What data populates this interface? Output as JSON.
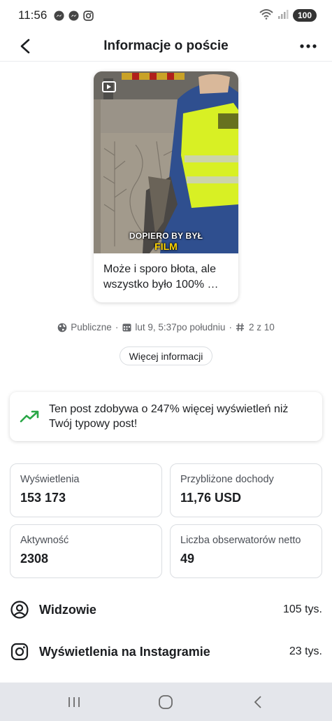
{
  "status_bar": {
    "time": "11:56",
    "battery": "100",
    "icons": [
      "messenger-icon",
      "messenger-icon",
      "instagram-icon",
      "wifi-icon",
      "signal-icon"
    ]
  },
  "header": {
    "title": "Informacje o poście",
    "back_icon": "back-arrow-icon",
    "more_icon": "more-dots-icon"
  },
  "post": {
    "overlay_line1": "DOPIERO BY BYŁ",
    "overlay_line2": "FILM",
    "caption": "Może i sporo błota, ale wszystko było 100% …",
    "colors": {
      "vest": "#d8f024",
      "jacket": "#2f4f8f",
      "background": "#8c8579"
    }
  },
  "meta": {
    "visibility": "Publiczne",
    "date": "lut 9, 5:37po południu",
    "position": "2 z 10",
    "separator": "·"
  },
  "more_info_label": "Więcej informacji",
  "banner": {
    "text": "Ten post zdobywa o 247% więcej wyświetleń niż Twój typowy post!",
    "accent_color": "#2aa747"
  },
  "stats": [
    {
      "label": "Wyświetlenia",
      "value": "153 173"
    },
    {
      "label": "Przybliżone dochody",
      "value": "11,76 USD"
    },
    {
      "label": "Aktywność",
      "value": "2308"
    },
    {
      "label": "Liczba obserwatorów netto",
      "value": "49"
    }
  ],
  "rows": [
    {
      "icon": "user-circle-icon",
      "label": "Widzowie",
      "value": "105 tys."
    },
    {
      "icon": "instagram-icon",
      "label": "Wyświetlenia na Instagramie",
      "value": "23 tys."
    }
  ],
  "nav": [
    "recents-icon",
    "home-icon",
    "back-icon"
  ]
}
